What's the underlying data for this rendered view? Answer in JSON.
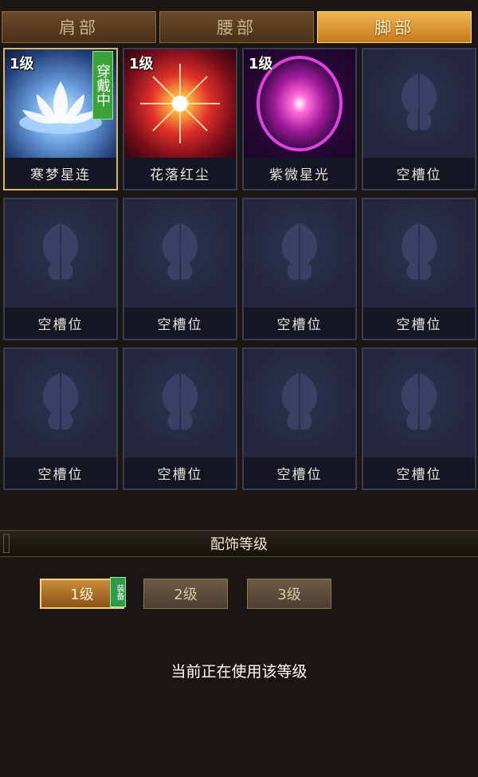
{
  "tabs": [
    {
      "label": "肩部",
      "active": false
    },
    {
      "label": "腰部",
      "active": false
    },
    {
      "label": "脚部",
      "active": true
    }
  ],
  "slots": [
    {
      "name": "寒梦星连",
      "level": "1级",
      "worn": "穿戴中",
      "icon": "lotus-icon"
    },
    {
      "name": "花落红尘",
      "level": "1级",
      "icon": "red-burst-icon"
    },
    {
      "name": "紫微星光",
      "level": "1级",
      "icon": "purple-orb-icon"
    },
    {
      "name": "空槽位",
      "icon": "butterfly-placeholder-icon"
    },
    {
      "name": "空槽位",
      "icon": "butterfly-placeholder-icon"
    },
    {
      "name": "空槽位",
      "icon": "butterfly-placeholder-icon"
    },
    {
      "name": "空槽位",
      "icon": "butterfly-placeholder-icon"
    },
    {
      "name": "空槽位",
      "icon": "butterfly-placeholder-icon"
    },
    {
      "name": "空槽位",
      "icon": "butterfly-placeholder-icon"
    },
    {
      "name": "空槽位",
      "icon": "butterfly-placeholder-icon"
    },
    {
      "name": "空槽位",
      "icon": "butterfly-placeholder-icon"
    },
    {
      "name": "空槽位",
      "icon": "butterfly-placeholder-icon"
    }
  ],
  "section_title": "配饰等级",
  "levels": [
    {
      "label": "1级",
      "active": true,
      "tag": "装备"
    },
    {
      "label": "2级",
      "active": false
    },
    {
      "label": "3级",
      "active": false
    }
  ],
  "status_text": "当前正在使用该等级",
  "colors": {
    "background": "#1a1612",
    "tab_active": "#e09a38",
    "slot_bg": "#1e2236",
    "worn_tag": "#3aa238",
    "selected_border": "#d9b66a"
  }
}
